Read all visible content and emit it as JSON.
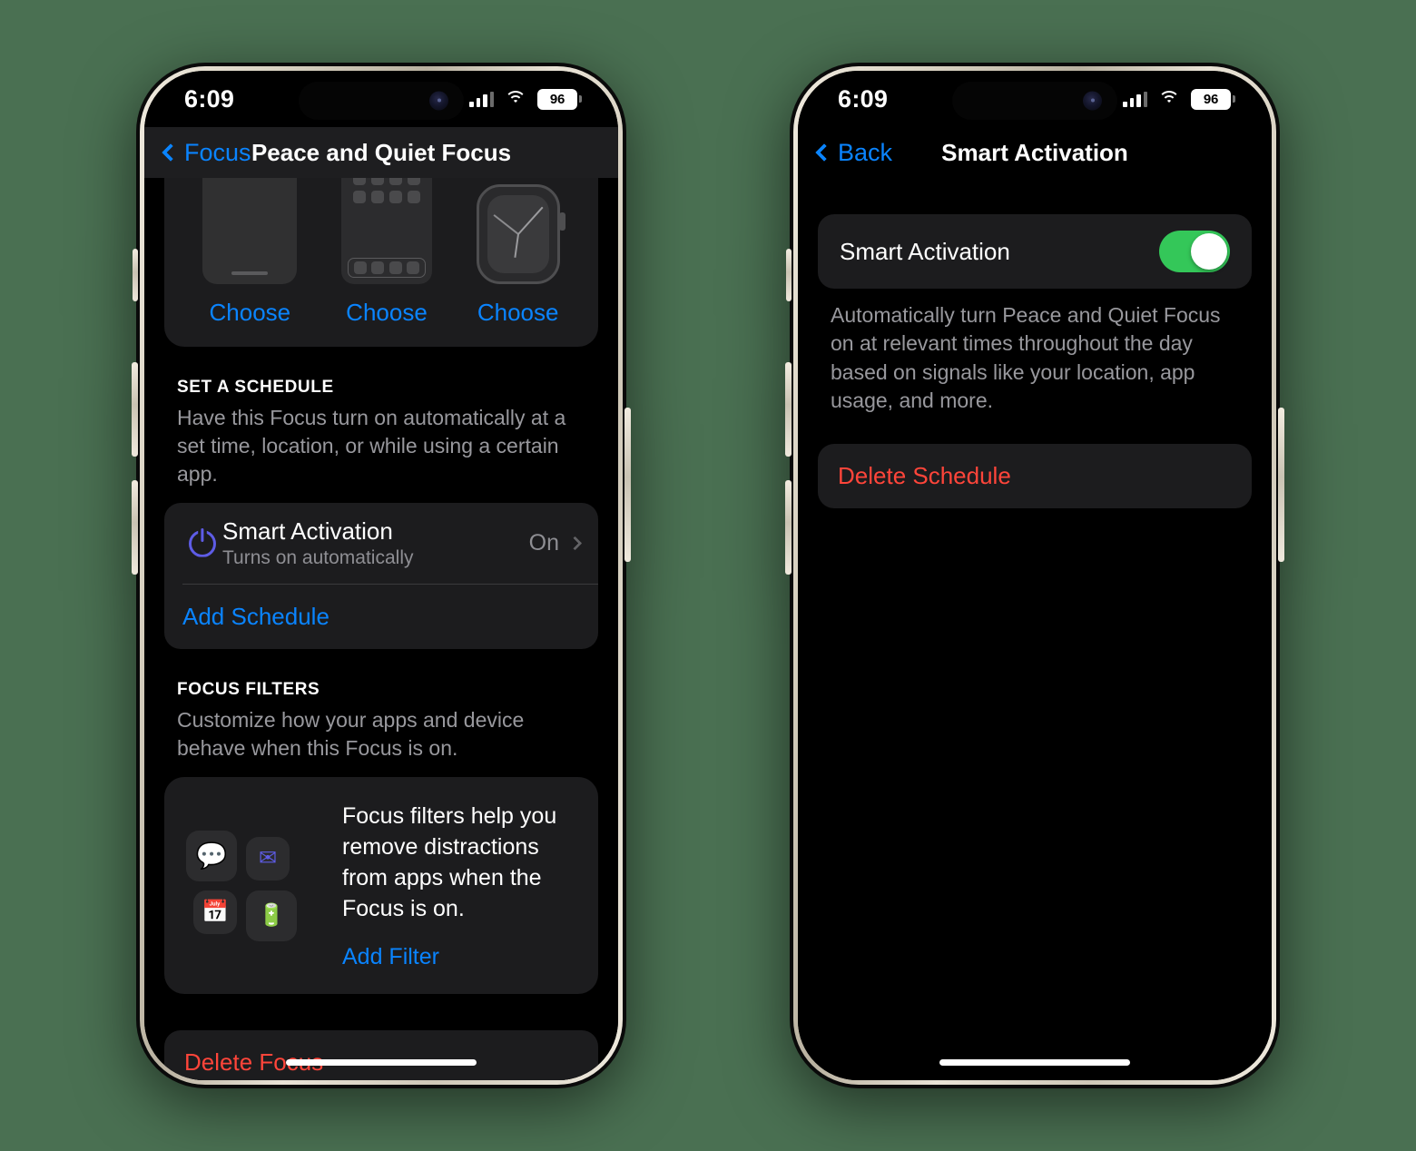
{
  "background_color": "#4a7052",
  "accent_blue": "#0a84ff",
  "accent_purple": "#5e5ce6",
  "accent_green": "#34c759",
  "accent_red": "#ff453a",
  "phones": [
    {
      "id": "focus-detail",
      "status_bar": {
        "time": "6:09",
        "battery_percent": "96",
        "cellular_icon": "cellular-bars-icon",
        "wifi_icon": "wifi-icon",
        "battery_icon": "battery-icon"
      },
      "nav": {
        "back_label": "Focus",
        "back_icon": "chevron-left-icon",
        "title": "Peace and Quiet Focus"
      },
      "customize": {
        "options": [
          {
            "device": "lock-screen",
            "label": "Choose"
          },
          {
            "device": "home-screen",
            "label": "Choose"
          },
          {
            "device": "apple-watch",
            "label": "Choose"
          }
        ]
      },
      "schedule_section": {
        "header": "SET A SCHEDULE",
        "description": "Have this Focus turn on automatically at a set time, location, or while using a certain app.",
        "rows": [
          {
            "icon": "power-icon",
            "title": "Smart Activation",
            "subtitle": "Turns on automatically",
            "value": "On",
            "chevron": "chevron-right-icon"
          }
        ],
        "add_label": "Add Schedule"
      },
      "filters_section": {
        "header": "FOCUS FILTERS",
        "description": "Customize how your apps and device behave when this Focus is on.",
        "promo_copy": "Focus filters help you remove distractions from apps when the Focus is on.",
        "promo_link": "Add Filter",
        "icons": [
          "message-bubble-icon",
          "envelope-icon",
          "calendar-icon",
          "battery-low-icon"
        ]
      },
      "delete": {
        "label": "Delete Focus"
      }
    },
    {
      "id": "smart-activation",
      "status_bar": {
        "time": "6:09",
        "battery_percent": "96",
        "cellular_icon": "cellular-bars-icon",
        "wifi_icon": "wifi-icon",
        "battery_icon": "battery-icon"
      },
      "nav": {
        "back_label": "Back",
        "back_icon": "chevron-left-icon",
        "title": "Smart Activation"
      },
      "toggle_row": {
        "label": "Smart Activation",
        "state": "on"
      },
      "description": "Automatically turn Peace and Quiet Focus on at relevant times throughout the day based on signals like your location, app usage, and more.",
      "delete": {
        "label": "Delete Schedule"
      }
    }
  ]
}
